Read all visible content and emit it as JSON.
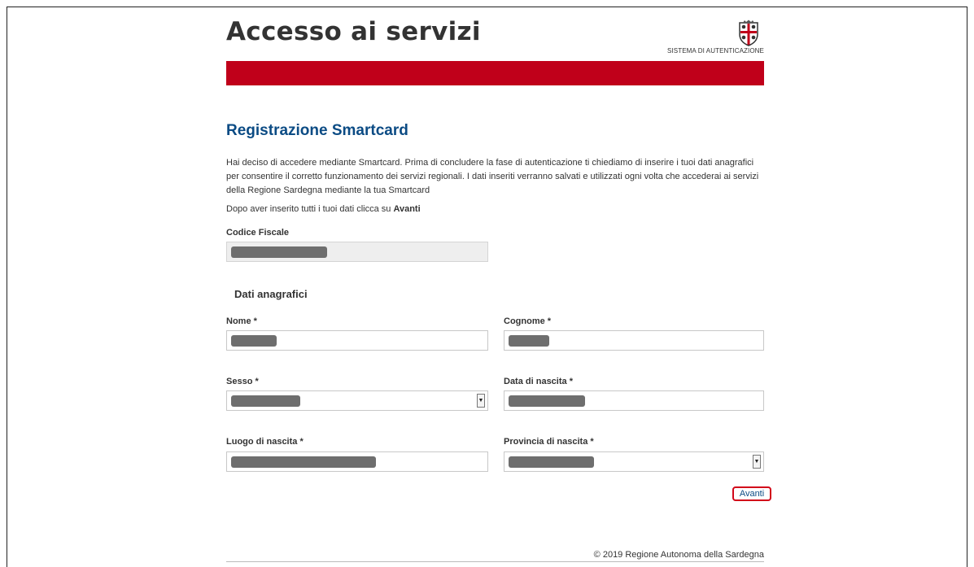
{
  "header": {
    "title": "Accesso ai servizi",
    "subtitle": "SISTEMA DI AUTENTICAZIONE",
    "logo_icon": "regione-sardegna-coat-of-arms-icon",
    "bar_color": "#c0001a"
  },
  "page": {
    "title": "Registrazione Smartcard",
    "intro": "Hai deciso di accedere mediante Smartcard. Prima di concludere la fase di autenticazione ti chiediamo di inserire i tuoi dati anagrafici per consentire il corretto funzionamento dei servizi regionali. I dati inseriti verranno salvati e utilizzati ogni volta che accederai ai servizi della Regione Sardegna mediante la tua Smartcard",
    "instruction_prefix": "Dopo aver inserito tutti i tuoi dati clicca su ",
    "instruction_bold": "Avanti"
  },
  "form": {
    "codice_fiscale_label": "Codice Fiscale",
    "section_title": "Dati anagrafici",
    "nome_label": "Nome *",
    "cognome_label": "Cognome *",
    "sesso_label": "Sesso *",
    "data_nascita_label": "Data di nascita *",
    "luogo_nascita_label": "Luogo di nascita *",
    "provincia_nascita_label": "Provincia di nascita *",
    "submit_label": "Avanti"
  },
  "footer": {
    "copyright": "© 2019 Regione Autonoma della Sardegna"
  },
  "colors": {
    "accent_red": "#c0001a",
    "title_blue": "#0b4b84",
    "highlight_red": "#d2071a"
  }
}
